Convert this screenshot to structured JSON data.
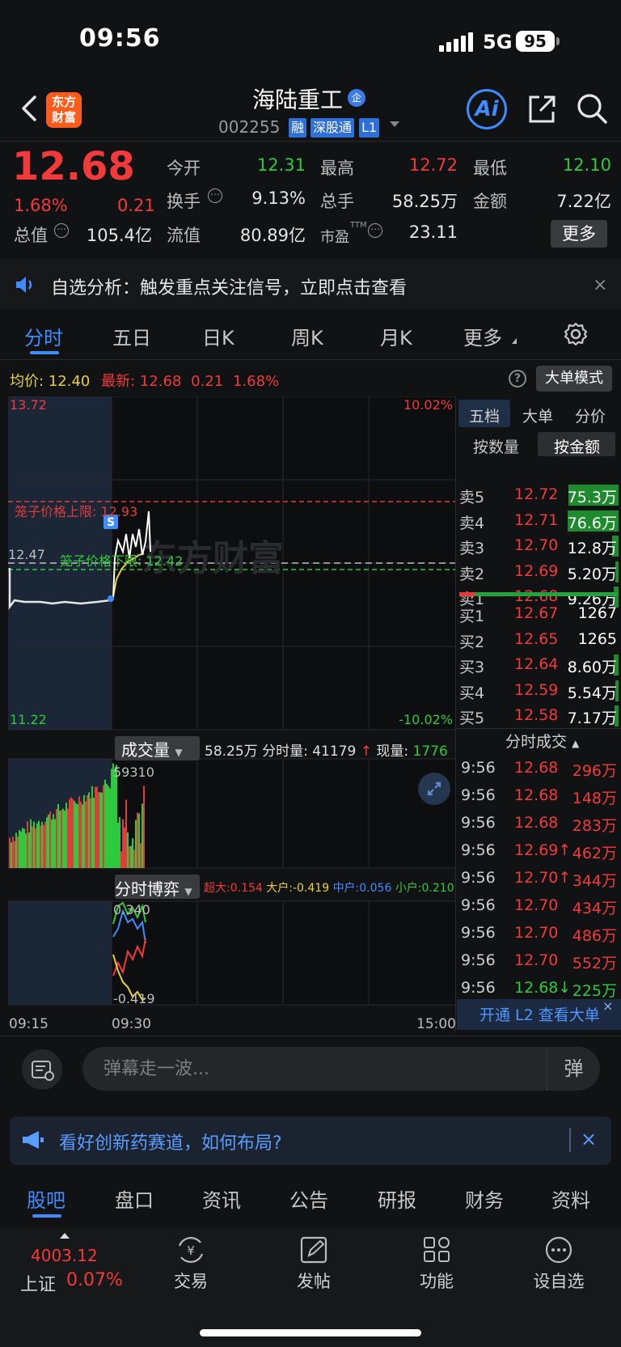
{
  "status_bar": {
    "time": "09:56",
    "network": "5G",
    "battery": "95"
  },
  "header": {
    "logo": "东方\n财富",
    "stock_name": "海陆重工",
    "badge": "企",
    "code": "002255",
    "tags": [
      "融",
      "深股通",
      "L1"
    ],
    "ai_label": "Ai"
  },
  "quote": {
    "price": "12.68",
    "change_pct": "1.68%",
    "change": "0.21",
    "fields": [
      {
        "label": "今开",
        "value": "12.31",
        "color": "#2fc93d"
      },
      {
        "label": "最高",
        "value": "12.72",
        "color": "#f33a3a"
      },
      {
        "label": "最低",
        "value": "12.10",
        "color": "#2fc93d"
      },
      {
        "label": "换手",
        "value": "9.13%",
        "color": "#e6e6e6"
      },
      {
        "label": "总手",
        "value": "58.25万",
        "color": "#e6e6e6"
      },
      {
        "label": "金额",
        "value": "7.22亿",
        "color": "#e6e6e6"
      },
      {
        "label": "总值",
        "value": "105.4亿",
        "color": "#e6e6e6"
      },
      {
        "label": "流值",
        "value": "80.89亿",
        "color": "#e6e6e6"
      },
      {
        "label": "市盈",
        "value": "23.11",
        "color": "#e6e6e6"
      }
    ],
    "pe_superscript": "TTM",
    "more_label": "更多"
  },
  "notice": {
    "text": "自选分析：触发重点关注信号，立即点击查看",
    "close": "×"
  },
  "chart_tabs": [
    "分时",
    "五日",
    "日K",
    "周K",
    "月K",
    "更多"
  ],
  "chart_info": {
    "avg_label": "均价:",
    "avg_value": "12.40",
    "latest_label": "最新:",
    "latest_value": "12.68",
    "latest_change": "0.21",
    "latest_pct": "1.68%",
    "help": "?",
    "big_order_mode": "大单模式"
  },
  "chart_labels": {
    "y_max": "13.72",
    "y_min": "11.22",
    "y_ref": "12.47",
    "pct_max": "10.02%",
    "pct_min": "-10.02%",
    "upper_limit": "笼子价格上限: 12.93",
    "lower_limit": "笼子价格下限: 12.42",
    "s_marker": "S",
    "watermark": "东方财富",
    "vol_max": "59310",
    "game_max": "0.340",
    "game_min": "-0.419",
    "time_start": "09:15",
    "time_mid": "09:30",
    "time_end": "15:00"
  },
  "volume": {
    "selector": "成交量",
    "total": "58.25万",
    "fenshi_label": "分时量:",
    "fenshi_value": "41179",
    "now_label": "现量:",
    "now_value": "1776"
  },
  "game": {
    "selector": "分时博弈",
    "items": [
      {
        "label": "超大:0.154",
        "color": "#f33a3a"
      },
      {
        "label": "大户:-0.419",
        "color": "#e9d03a"
      },
      {
        "label": "中户:0.056",
        "color": "#3f8cff"
      },
      {
        "label": "小户:0.210",
        "color": "#2fc93d"
      }
    ]
  },
  "order_book": {
    "tabs": [
      "五档",
      "大单",
      "分价"
    ],
    "modes": [
      "按数量",
      "按金额"
    ],
    "asks": [
      {
        "label": "卖5",
        "price": "12.72",
        "amount": "75.3万",
        "fill": 0.62
      },
      {
        "label": "卖4",
        "price": "12.71",
        "amount": "76.6万",
        "fill": 0.63
      },
      {
        "label": "卖3",
        "price": "12.70",
        "amount": "12.8万",
        "fill": 0.08
      },
      {
        "label": "卖2",
        "price": "12.69",
        "amount": "5.20万",
        "fill": 0.04
      },
      {
        "label": "卖1",
        "price": "12.68",
        "amount": "9.26万",
        "fill": 0.06
      }
    ],
    "bids": [
      {
        "label": "买1",
        "price": "12.67",
        "amount": "1267",
        "fill": 0
      },
      {
        "label": "买2",
        "price": "12.65",
        "amount": "1265",
        "fill": 0
      },
      {
        "label": "买3",
        "price": "12.64",
        "amount": "8.60万",
        "fill": 0.06
      },
      {
        "label": "买4",
        "price": "12.59",
        "amount": "5.54万",
        "fill": 0.04
      },
      {
        "label": "买5",
        "price": "12.58",
        "amount": "7.17万",
        "fill": 0.05
      }
    ]
  },
  "ticks": {
    "header": "分时成交",
    "rows": [
      {
        "time": "9:56",
        "price": "12.68",
        "arrow": "",
        "amount": "296万",
        "color": "#f33a3a"
      },
      {
        "time": "9:56",
        "price": "12.68",
        "arrow": "",
        "amount": "148万",
        "color": "#f33a3a"
      },
      {
        "time": "9:56",
        "price": "12.68",
        "arrow": "",
        "amount": "283万",
        "color": "#f33a3a"
      },
      {
        "time": "9:56",
        "price": "12.69",
        "arrow": "↑",
        "amount": "462万",
        "color": "#f33a3a"
      },
      {
        "time": "9:56",
        "price": "12.70",
        "arrow": "↑",
        "amount": "344万",
        "color": "#f33a3a"
      },
      {
        "time": "9:56",
        "price": "12.70",
        "arrow": "",
        "amount": "434万",
        "color": "#f33a3a"
      },
      {
        "time": "9:56",
        "price": "12.70",
        "arrow": "",
        "amount": "486万",
        "color": "#f33a3a"
      },
      {
        "time": "9:56",
        "price": "12.70",
        "arrow": "",
        "amount": "552万",
        "color": "#f33a3a"
      },
      {
        "time": "9:56",
        "price": "12.68",
        "arrow": "↓",
        "amount": "225万",
        "color": "#2fc93d"
      }
    ],
    "l2_banner": "开通 L2 查看大单",
    "l2_close": "×"
  },
  "danmaku": {
    "placeholder": "弹幕走一波...",
    "toggle": "弹"
  },
  "promo": {
    "text": "看好创新药赛道，如何布局?",
    "close": "×"
  },
  "section_tabs": [
    "股吧",
    "盘口",
    "资讯",
    "公告",
    "研报",
    "财务",
    "资料"
  ],
  "bottom_nav": {
    "index_value": "4003.12",
    "index_name": "上证",
    "index_pct": "0.07%",
    "items": [
      "交易",
      "发帖",
      "功能",
      "设自选"
    ]
  }
}
